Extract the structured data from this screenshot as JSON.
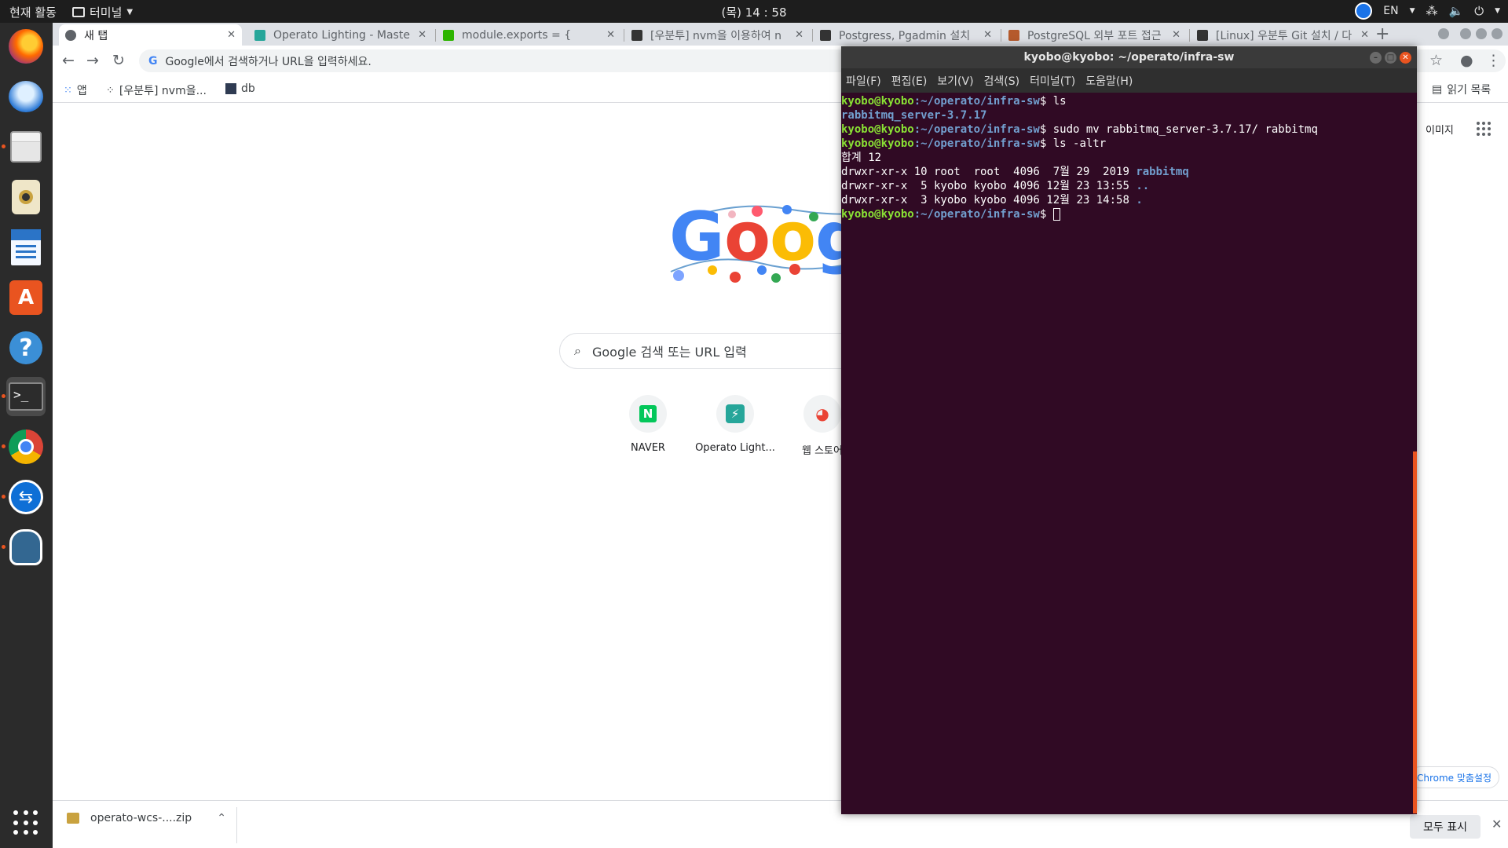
{
  "topbar": {
    "activities": "현재 활동",
    "app_name": "터미널",
    "clock": "(목) 14 : 58",
    "lang": "EN"
  },
  "chrome": {
    "tabs": [
      {
        "title": "새 탭",
        "color": "#5f6368"
      },
      {
        "title": "Operato Lighting - Maste",
        "color": "#26a69a"
      },
      {
        "title": "module.exports = {",
        "color": "#2db400"
      },
      {
        "title": "[우분투] nvm을 이용하여 n",
        "color": "#333333"
      },
      {
        "title": "Postgress, Pgadmin 설치",
        "color": "#333333"
      },
      {
        "title": "PostgreSQL 외부 포트 접근",
        "color": "#b55a2c"
      },
      {
        "title": "[Linux] 우분투 Git 설치 / 다",
        "color": "#333333"
      }
    ],
    "url_placeholder": "Google에서 검색하거나 URL을 입력하세요.",
    "bookmarks": [
      {
        "label": "앱"
      },
      {
        "label": "[우분투] nvm을..."
      },
      {
        "label": "db"
      }
    ],
    "reading_list": "읽기 목록",
    "images_link": "이미지",
    "search_placeholder": "Google 검색 또는 URL 입력",
    "shortcuts": [
      {
        "label": "NAVER",
        "icon": "N"
      },
      {
        "label": "Operato Light...",
        "icon": "⚡"
      },
      {
        "label": "웹 스토어",
        "icon": "◕"
      }
    ],
    "customize": "Chrome 맞춤설정",
    "download": {
      "file": "operato-wcs-....zip",
      "show_all": "모두 표시"
    }
  },
  "terminal": {
    "title": "kyobo@kyobo: ~/operato/infra-sw",
    "menu": [
      "파일(F)",
      "편집(E)",
      "보기(V)",
      "검색(S)",
      "터미널(T)",
      "도움말(H)"
    ],
    "prompt_user": "kyobo@kyobo",
    "prompt_path": ":~/operato/infra-sw",
    "cmd1": "$ ls",
    "out1": "rabbitmq_server-3.7.17",
    "cmd2": "$ sudo mv rabbitmq_server-3.7.17/ rabbitmq",
    "cmd3": "$ ls -altr",
    "total": "합계 12",
    "row1_prefix": "drwxr-xr-x 10 root  root  4096  7월 29  2019 ",
    "row1_name": "rabbitmq",
    "row2_prefix": "drwxr-xr-x  5 kyobo kyobo 4096 12월 23 13:55 ",
    "row2_name": "..",
    "row3_prefix": "drwxr-xr-x  3 kyobo kyobo 4096 12월 23 14:58 ",
    "row3_name": ".",
    "cmd4": "$ "
  }
}
